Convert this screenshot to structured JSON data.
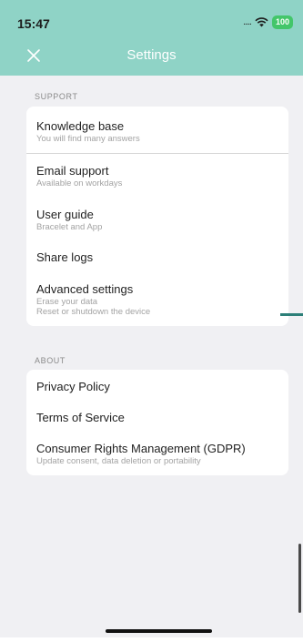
{
  "status_bar": {
    "time": "15:47",
    "signal": ".....",
    "battery": "100"
  },
  "header": {
    "title": "Settings",
    "close_icon": "close-icon"
  },
  "support": {
    "label": "SUPPORT",
    "items": [
      {
        "title": "Knowledge base",
        "subtitle": "You will find many answers"
      },
      {
        "title": "Email support",
        "subtitle": "Available on workdays"
      },
      {
        "title": "User guide",
        "subtitle": "Bracelet and App"
      },
      {
        "title": "Share logs"
      },
      {
        "title": "Advanced settings",
        "subtitle": "Erase your data",
        "subtitle2": "Reset or shutdown the device"
      }
    ]
  },
  "about": {
    "label": "ABOUT",
    "items": [
      {
        "title": "Privacy Policy"
      },
      {
        "title": "Terms of Service"
      },
      {
        "title": "Consumer Rights Management (GDPR)",
        "subtitle": "Update consent, data deletion or portability"
      }
    ]
  },
  "colors": {
    "header": "#8fd3c6",
    "battery": "#43c66a",
    "accent": "#2c7f78"
  }
}
